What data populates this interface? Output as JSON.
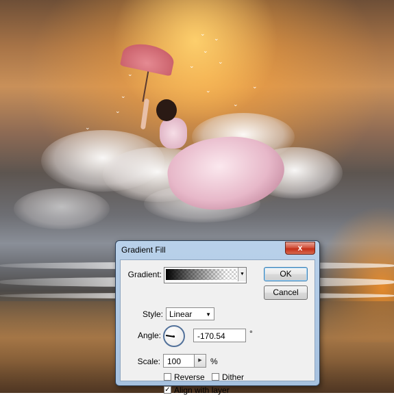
{
  "dialog": {
    "title": "Gradient Fill",
    "close_glyph": "x",
    "gradient_label": "Gradient:",
    "style_label": "Style:",
    "style_value": "Linear",
    "angle_label": "Angle:",
    "angle_value": "-170.54",
    "degree_symbol": "°",
    "scale_label": "Scale:",
    "scale_value": "100",
    "percent_symbol": "%",
    "reverse_label": "Reverse",
    "reverse_checked": false,
    "dither_label": "Dither",
    "dither_checked": false,
    "align_label": "Align with layer",
    "align_checked": true,
    "ok_label": "OK",
    "cancel_label": "Cancel"
  },
  "icons": {
    "dropdown": "chevron-down-icon",
    "spin": "chevron-right-icon",
    "check": "checkmark-icon",
    "close": "close-icon"
  },
  "colors": {
    "titlebar": "#b9d1ea",
    "close_button": "#c42f18",
    "client_background": "#f0f0f0",
    "default_button_border": "#3c7fb1"
  }
}
